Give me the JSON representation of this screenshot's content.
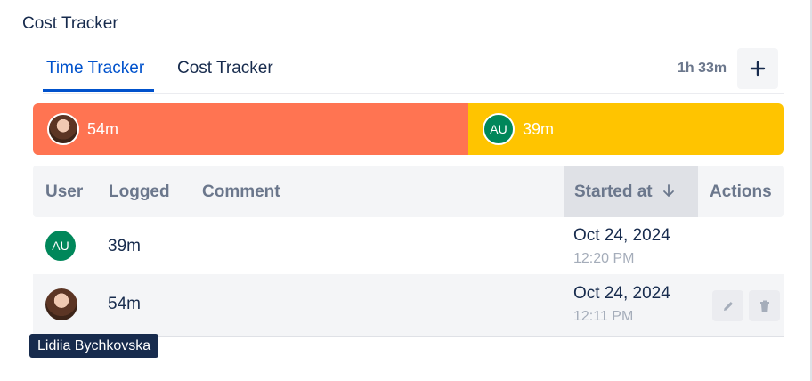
{
  "app": {
    "title": "Cost Tracker"
  },
  "tabs": [
    {
      "label": "Time Tracker",
      "active": true
    },
    {
      "label": "Cost Tracker",
      "active": false
    }
  ],
  "summary": {
    "total": "1h 33m",
    "add_icon": "plus-icon"
  },
  "breakdown": [
    {
      "user_initials": "",
      "avatar": "photo",
      "duration": "54m",
      "color": "#ff7452",
      "fraction": 0.58
    },
    {
      "user_initials": "AU",
      "avatar": "initials",
      "duration": "39m",
      "color": "#ffc400",
      "fraction": 0.42
    }
  ],
  "table": {
    "headers": {
      "user": "User",
      "logged": "Logged",
      "comment": "Comment",
      "started_at": "Started at",
      "actions": "Actions"
    },
    "sort": {
      "column": "started_at",
      "direction": "descending",
      "icon": "arrow-down-icon"
    },
    "rows": [
      {
        "user_initials": "AU",
        "avatar": "initials",
        "logged": "39m",
        "comment": "",
        "date": "Oct 24, 2024",
        "time": "12:20 PM",
        "actions_visible": false
      },
      {
        "user_initials": "",
        "avatar": "photo",
        "logged": "54m",
        "comment": "",
        "date": "Oct 24, 2024",
        "time": "12:11 PM",
        "actions_visible": true,
        "edit_icon": "pencil-icon",
        "delete_icon": "trash-icon"
      }
    ]
  },
  "tooltip": {
    "text": "Lidiia Bychkovska"
  },
  "colors": {
    "accent": "#0052cc",
    "avatar_green": "#00875a",
    "tooltip_bg": "#172b4d"
  }
}
